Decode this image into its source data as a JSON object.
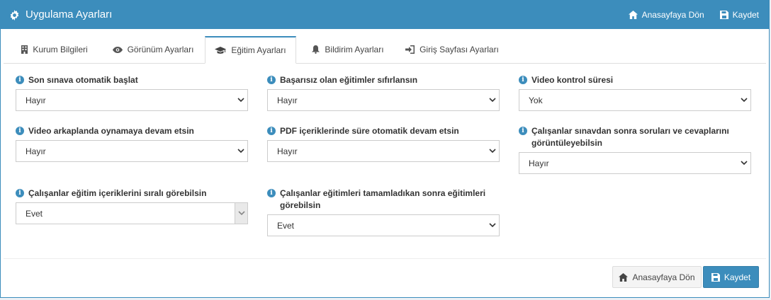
{
  "header": {
    "title": "Uygulama Ayarları",
    "home_label": "Anasayfaya Dön",
    "save_label": "Kaydet"
  },
  "tabs": [
    {
      "label": "Kurum Bilgileri",
      "icon": "building-icon"
    },
    {
      "label": "Görünüm Ayarları",
      "icon": "eye-icon"
    },
    {
      "label": "Eğitim Ayarları",
      "icon": "graduation-cap-icon",
      "active": true
    },
    {
      "label": "Bildirim Ayarları",
      "icon": "bell-icon"
    },
    {
      "label": "Giriş Sayfası Ayarları",
      "icon": "sign-in-icon"
    }
  ],
  "fields": [
    {
      "label": "Son sınava otomatik başlat",
      "value": "Hayır"
    },
    {
      "label": "Başarısız olan eğitimler sıfırlansın",
      "value": "Hayır"
    },
    {
      "label": "Video kontrol süresi",
      "value": "Yok"
    },
    {
      "label": "Video arkaplanda oynamaya devam etsin",
      "value": "Hayır"
    },
    {
      "label": "PDF içeriklerinde süre otomatik devam etsin",
      "value": "Hayır"
    },
    {
      "label": "Çalışanlar sınavdan sonra soruları ve cevaplarını görüntüleyebilsin",
      "value": "Hayır"
    },
    {
      "label": "Çalışanlar eğitim içeriklerini sıralı görebilsin",
      "value": "Evet"
    },
    {
      "label": "Çalışanlar eğitimleri tamamladıkan sonra eğitimleri görebilsin",
      "value": "Evet"
    }
  ],
  "footer": {
    "home_label": "Anasayfaya Dön",
    "save_label": "Kaydet"
  },
  "colors": {
    "primary": "#3c8dbc",
    "background": "#ecf0f5"
  }
}
